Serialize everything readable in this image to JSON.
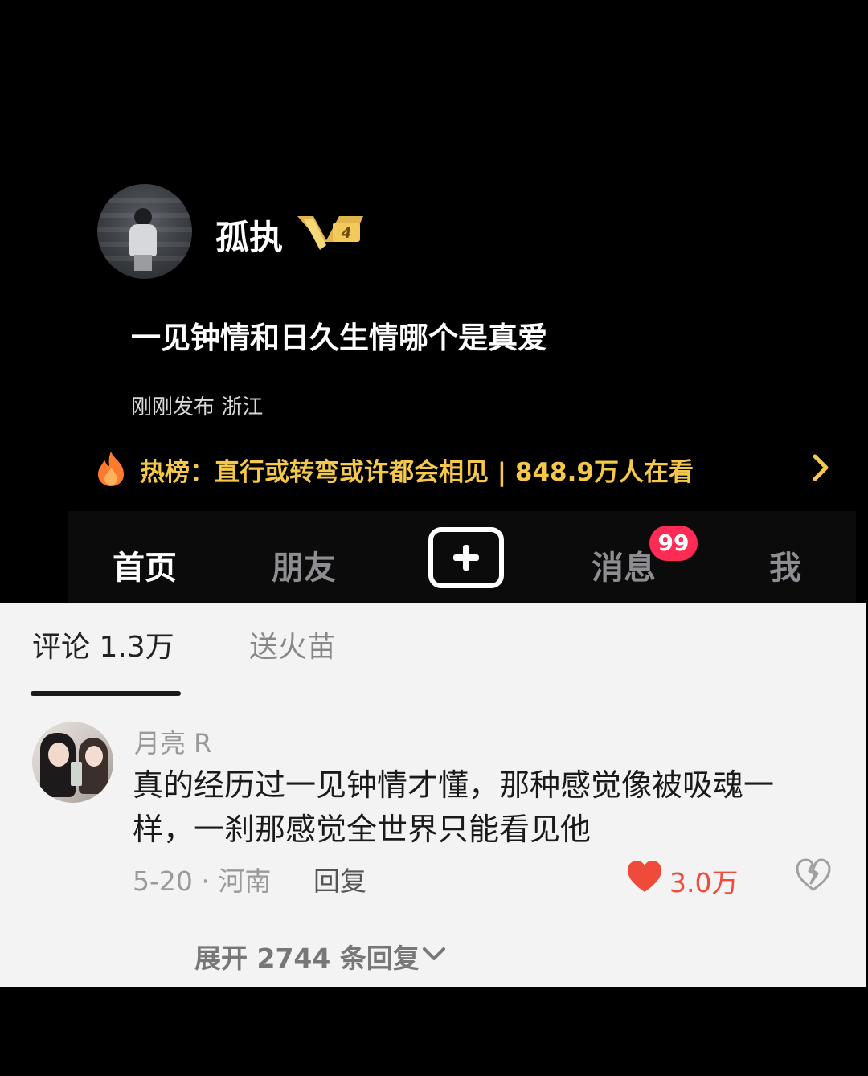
{
  "post": {
    "username": "孤执",
    "level_badge": "V4",
    "title": "一见钟情和日久生情哪个是真爱",
    "meta": "刚刚发布 浙江"
  },
  "hot_list": {
    "text": "热榜：直行或转弯或许都会相见 | 848.9万人在看",
    "icon": "flame-icon",
    "accent_color": "#f5c84a"
  },
  "tabbar": {
    "home": "首页",
    "friends": "朋友",
    "messages": "消息",
    "messages_badge": "99",
    "me": "我",
    "badge_color": "#fe2c55"
  },
  "comments": {
    "tab_comments": "评论 1.3万",
    "tab_gift": "送火苗",
    "item": {
      "user": "月亮 R",
      "text": "真的经历过一见钟情才懂，那种感觉像被吸魂一样，一刹那感觉全世界只能看见他",
      "meta": "5-20 · 河南",
      "reply_label": "回复",
      "like_count": "3.0万",
      "like_color": "#f04a3b"
    },
    "expand_label": "展开 2744 条回复"
  }
}
